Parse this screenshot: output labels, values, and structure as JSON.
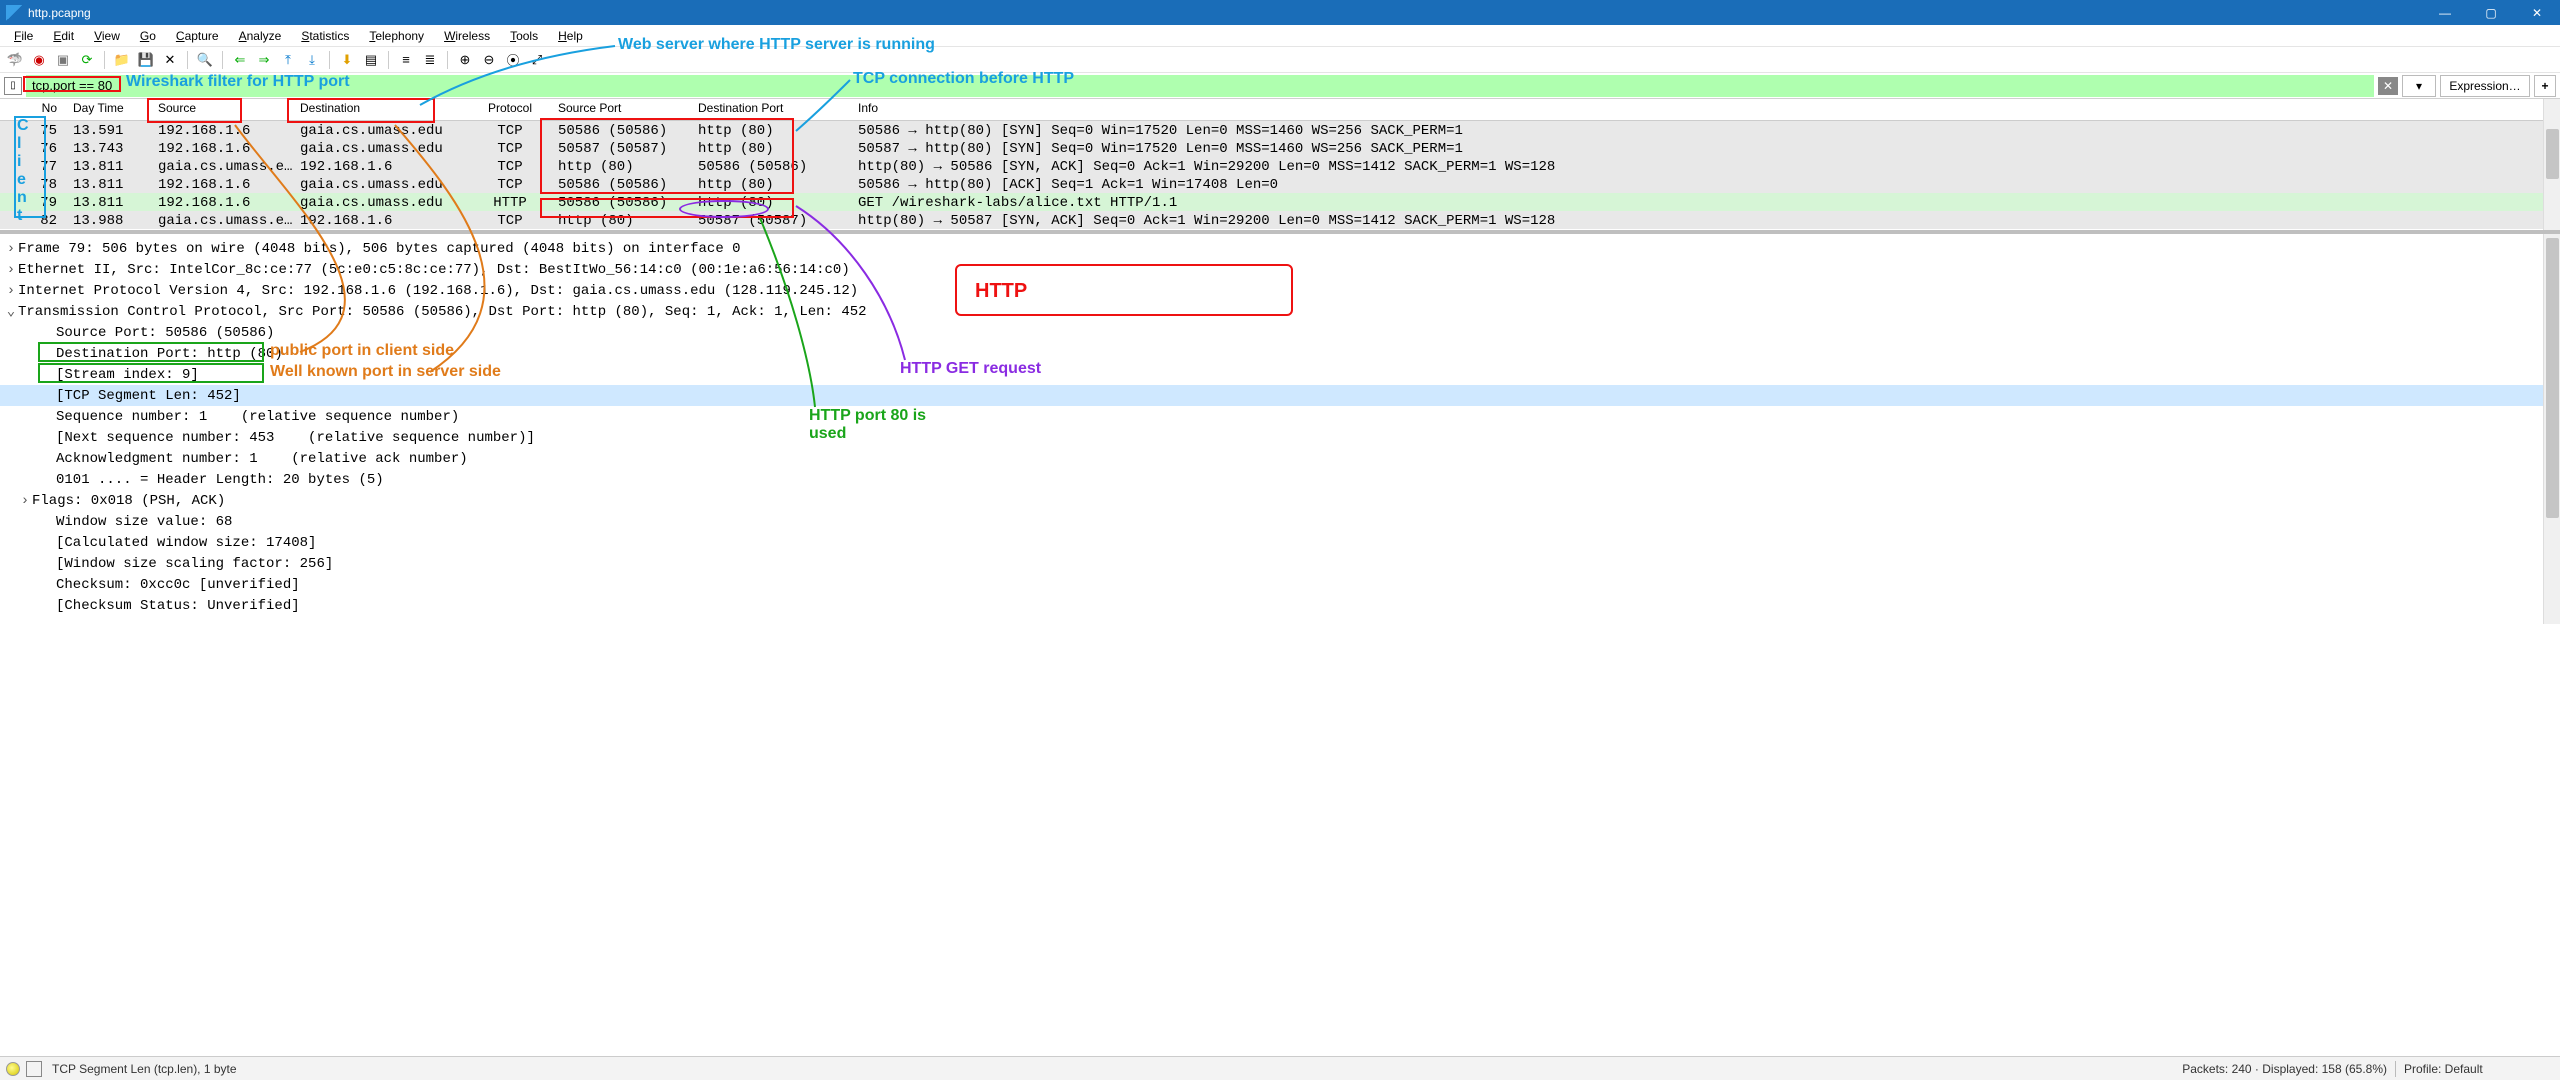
{
  "title": "http.pcapng",
  "menu": [
    "File",
    "Edit",
    "View",
    "Go",
    "Capture",
    "Analyze",
    "Statistics",
    "Telephony",
    "Wireless",
    "Tools",
    "Help"
  ],
  "filter": {
    "value": "tcp.port == 80",
    "expression": "Expression…"
  },
  "columns": [
    "No",
    "Day Time",
    "Source",
    "Destination",
    "Protocol",
    "Source Port",
    "Destination Port",
    "Info"
  ],
  "rows": [
    {
      "no": "75",
      "time": "13.591",
      "src": "192.168.1.6",
      "dst": "gaia.cs.umass.edu",
      "proto": "TCP",
      "sport": "50586 (50586)",
      "dport": "http (80)",
      "info": "50586 → http(80) [SYN] Seq=0 Win=17520 Len=0 MSS=1460 WS=256 SACK_PERM=1",
      "bg": "gray"
    },
    {
      "no": "76",
      "time": "13.743",
      "src": "192.168.1.6",
      "dst": "gaia.cs.umass.edu",
      "proto": "TCP",
      "sport": "50587 (50587)",
      "dport": "http (80)",
      "info": "50587 → http(80) [SYN] Seq=0 Win=17520 Len=0 MSS=1460 WS=256 SACK_PERM=1",
      "bg": "gray"
    },
    {
      "no": "77",
      "time": "13.811",
      "src": "gaia.cs.umass.e…",
      "dst": "192.168.1.6",
      "proto": "TCP",
      "sport": "http (80)",
      "dport": "50586 (50586)",
      "info": "http(80) → 50586 [SYN, ACK] Seq=0 Ack=1 Win=29200 Len=0 MSS=1412 SACK_PERM=1 WS=128",
      "bg": "gray"
    },
    {
      "no": "78",
      "time": "13.811",
      "src": "192.168.1.6",
      "dst": "gaia.cs.umass.edu",
      "proto": "TCP",
      "sport": "50586 (50586)",
      "dport": "http (80)",
      "info": "50586 → http(80) [ACK] Seq=1 Ack=1 Win=17408 Len=0",
      "bg": "gray"
    },
    {
      "no": "79",
      "time": "13.811",
      "src": "192.168.1.6",
      "dst": "gaia.cs.umass.edu",
      "proto": "HTTP",
      "sport": "50586 (50586)",
      "dport": "http (80)",
      "info": "GET /wireshark-labs/alice.txt HTTP/1.1",
      "bg": "green"
    },
    {
      "no": "82",
      "time": "13.988",
      "src": "gaia.cs.umass.e…",
      "dst": "192.168.1.6",
      "proto": "TCP",
      "sport": "http (80)",
      "dport": "50587 (50587)",
      "info": "http(80) → 50587 [SYN, ACK] Seq=0 Ack=1 Win=29200 Len=0 MSS=1412 SACK_PERM=1 WS=128",
      "bg": "gray"
    }
  ],
  "details": [
    {
      "t": ">",
      "txt": "Frame 79: 506 bytes on wire (4048 bits), 506 bytes captured (4048 bits) on interface 0",
      "ind": 0
    },
    {
      "t": ">",
      "txt": "Ethernet II, Src: IntelCor_8c:ce:77 (5c:e0:c5:8c:ce:77), Dst: BestItWo_56:14:c0 (00:1e:a6:56:14:c0)",
      "ind": 0
    },
    {
      "t": ">",
      "txt": "Internet Protocol Version 4, Src: 192.168.1.6 (192.168.1.6), Dst: gaia.cs.umass.edu (128.119.245.12)",
      "ind": 0
    },
    {
      "t": "v",
      "txt": "Transmission Control Protocol, Src Port: 50586 (50586), Dst Port: http (80), Seq: 1, Ack: 1, Len: 452",
      "ind": 0
    },
    {
      "t": "",
      "txt": "Source Port: 50586 (50586)",
      "ind": 2,
      "boxgreen": true
    },
    {
      "t": "",
      "txt": "Destination Port: http (80)",
      "ind": 2,
      "boxgreen": true
    },
    {
      "t": "",
      "txt": "[Stream index: 9]",
      "ind": 2
    },
    {
      "t": "",
      "txt": "[TCP Segment Len: 452]",
      "ind": 2,
      "sel": true
    },
    {
      "t": "",
      "txt": "Sequence number: 1    (relative sequence number)",
      "ind": 2
    },
    {
      "t": "",
      "txt": "[Next sequence number: 453    (relative sequence number)]",
      "ind": 2
    },
    {
      "t": "",
      "txt": "Acknowledgment number: 1    (relative ack number)",
      "ind": 2
    },
    {
      "t": "",
      "txt": "0101 .... = Header Length: 20 bytes (5)",
      "ind": 2
    },
    {
      "t": ">",
      "txt": "Flags: 0x018 (PSH, ACK)",
      "ind": 1
    },
    {
      "t": "",
      "txt": "Window size value: 68",
      "ind": 2
    },
    {
      "t": "",
      "txt": "[Calculated window size: 17408]",
      "ind": 2
    },
    {
      "t": "",
      "txt": "[Window size scaling factor: 256]",
      "ind": 2
    },
    {
      "t": "",
      "txt": "Checksum: 0xcc0c [unverified]",
      "ind": 2
    },
    {
      "t": "",
      "txt": "[Checksum Status: Unverified]",
      "ind": 2
    }
  ],
  "status": {
    "left": "TCP Segment Len (tcp.len), 1 byte",
    "mid": "Packets: 240 · Displayed: 158 (65.8%)",
    "prof": "Profile: Default"
  },
  "annotations": {
    "filter_label": "Wireshark filter for HTTP port",
    "client_label": "Client",
    "webserver_label": "Web server where HTTP server is running",
    "tcp_before_label": "TCP connection before HTTP",
    "http_box_label": "HTTP",
    "http_get_label": "HTTP GET request",
    "port80_label": "HTTP port 80 is\nused",
    "public_port_label": "public port in client side",
    "wellknown_label": "Well known port in server side"
  },
  "colors": {
    "blue": "#19a0df",
    "red": "#e11",
    "green": "#1aa51a",
    "orange": "#e07b1a",
    "purple": "#8a2be2"
  }
}
